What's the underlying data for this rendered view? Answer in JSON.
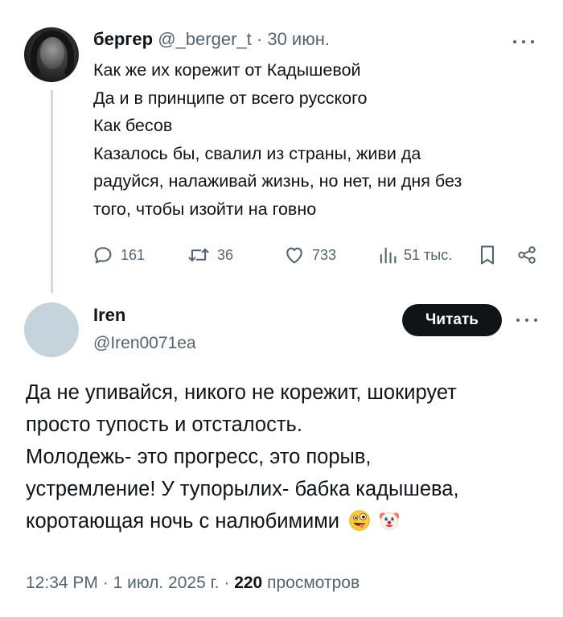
{
  "tweet1": {
    "name": "бергер",
    "handle": "@_berger_t",
    "separator": "·",
    "date": "30 июн.",
    "lines": [
      "Как же их корежит от Кадышевой",
      "Да и в принципе от всего русского",
      "Как бесов",
      "Казалось бы, свалил из страны, живи да",
      "радуйся, налаживай жизнь, но нет, ни дня без",
      "того, чтобы изойти на говно"
    ],
    "actions": {
      "replies": "161",
      "retweets": "36",
      "likes": "733",
      "views": "51 тыс."
    }
  },
  "tweet2": {
    "name": "Iren",
    "handle": "@Iren0071ea",
    "follow_label": "Читать",
    "lines": [
      "Да не упивайся, никого не корежит, шокирует",
      "просто тупость и отсталость.",
      "Молодежь- это прогресс, это порыв,",
      "устремление! У тупорылих- бабка кадышева,",
      "коротающая ночь с налюбимими"
    ],
    "emojis": [
      "zany-face-emoji",
      "clown-face-emoji"
    ],
    "footer": {
      "time": "12:34 PM",
      "sep1": "·",
      "date": "1 июл. 2025 г.",
      "sep2": "·",
      "views_count": "220",
      "views_label": "просмотров"
    }
  },
  "icons": {
    "reply": "speech-bubble-icon",
    "retweet": "retweet-arrows-icon",
    "like": "heart-icon",
    "views": "bar-chart-icon",
    "bookmark": "bookmark-icon",
    "share": "share-icon",
    "more": "ellipsis-icon"
  },
  "colors": {
    "text": "#0f1419",
    "muted": "#536471",
    "thread_line": "#cfd9de",
    "button_bg": "#0f1419",
    "button_text": "#ffffff",
    "placeholder_avatar": "#c5d3dc"
  }
}
